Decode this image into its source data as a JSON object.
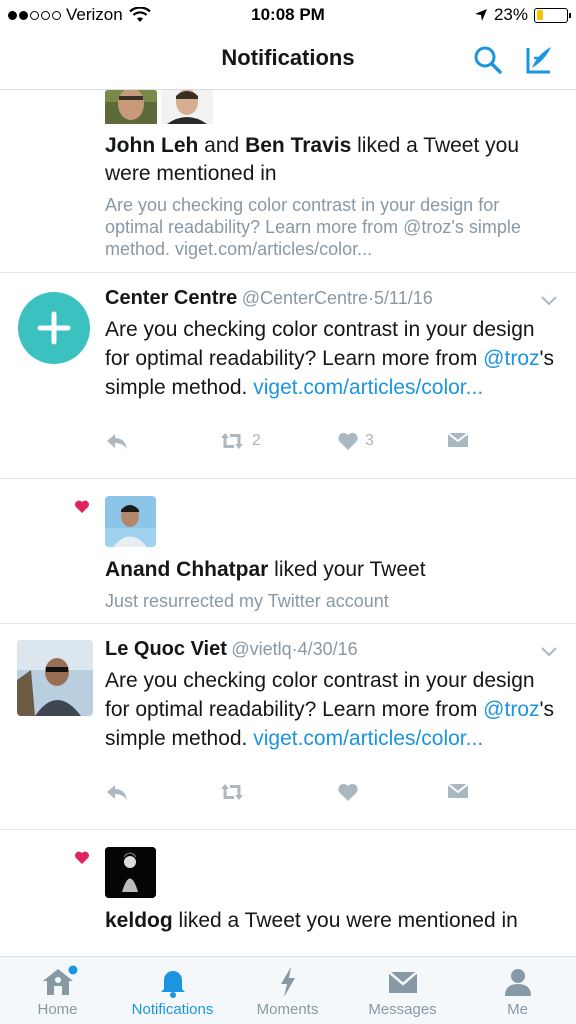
{
  "status_bar": {
    "carrier": "Verizon",
    "time": "10:08 PM",
    "battery_percent": "23%",
    "battery_level": 0.23,
    "battery_color": "#f2c30f"
  },
  "header": {
    "title": "Notifications",
    "accent": "#1b95e0"
  },
  "notifications": [
    {
      "user1": "John Leh",
      "joiner": " and ",
      "user2": "Ben Travis",
      "action_text": " liked a Tweet you were mentioned in",
      "tweet_preview": "Are you checking color contrast in your design for optimal readability? Learn more from @troz's simple method.  viget.com/articles/color..."
    },
    {
      "name": "Center Centre",
      "handle": "@CenterCentre",
      "separator": "·",
      "date": "5/11/16",
      "text_a": "Are you checking color contrast in your design for optimal readability? Learn more from ",
      "mention": "@troz",
      "text_b": "'s simple method.  ",
      "link": "viget.com/articles/color...",
      "retweets": "2",
      "likes": "3",
      "avatar_color": "#3cc1c1"
    },
    {
      "name": "Anand Chhatpar",
      "action_text": " liked your Tweet",
      "tweet_preview": "Just resurrected my Twitter account",
      "heart_color": "#e0245e"
    },
    {
      "name": "Le Quoc Viet",
      "handle": "@vietlq",
      "separator": "·",
      "date": "4/30/16",
      "text_a": "Are you checking color contrast in your design for optimal readability? Learn more from ",
      "mention": "@troz",
      "text_b": "'s simple method.  ",
      "link": "viget.com/articles/color..."
    },
    {
      "name": "keldog",
      "action_text": " liked a Tweet you were mentioned in"
    }
  ],
  "tab_bar": {
    "tabs": [
      {
        "label": "Home",
        "icon": "home-icon"
      },
      {
        "label": "Notifications",
        "icon": "bell-icon"
      },
      {
        "label": "Moments",
        "icon": "lightning-icon"
      },
      {
        "label": "Messages",
        "icon": "envelope-icon"
      },
      {
        "label": "Me",
        "icon": "person-icon"
      }
    ],
    "active": "Notifications"
  }
}
